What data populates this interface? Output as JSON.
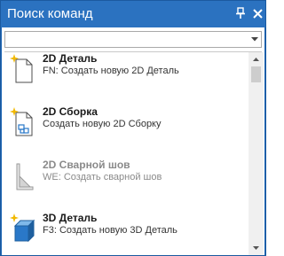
{
  "panel": {
    "title": "Поиск команд",
    "pin_glyph": "✲",
    "close_glyph": "✕"
  },
  "search": {
    "value": "",
    "placeholder": ""
  },
  "commands": [
    {
      "name": "2D Деталь",
      "description": "FN: Создать новую 2D Деталь",
      "icon": "2d-part-icon",
      "enabled": true
    },
    {
      "name": "2D Сборка",
      "description": "Создать новую 2D Сборку",
      "icon": "2d-assembly-icon",
      "enabled": true
    },
    {
      "name": "2D Сварной шов",
      "description": "WE: Создать сварной шов",
      "icon": "weld-seam-icon",
      "enabled": false
    },
    {
      "name": "3D Деталь",
      "description": "F3: Создать новую 3D Деталь",
      "icon": "3d-part-icon",
      "enabled": true
    }
  ],
  "colors": {
    "titlebar": "#2b72c0",
    "accent_blue": "#2a78c8",
    "sparkle": "#f2b900"
  }
}
